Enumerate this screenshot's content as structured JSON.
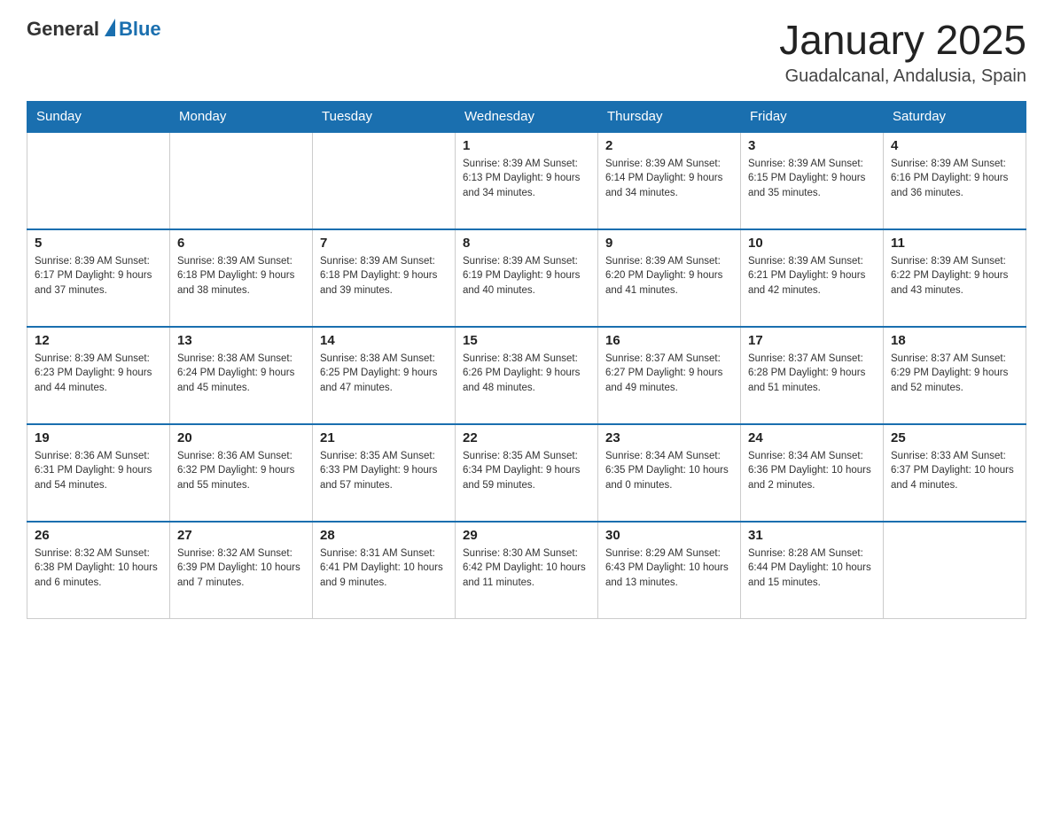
{
  "logo": {
    "general": "General",
    "blue": "Blue"
  },
  "title": "January 2025",
  "location": "Guadalcanal, Andalusia, Spain",
  "weekdays": [
    "Sunday",
    "Monday",
    "Tuesday",
    "Wednesday",
    "Thursday",
    "Friday",
    "Saturday"
  ],
  "weeks": [
    [
      {
        "day": "",
        "info": ""
      },
      {
        "day": "",
        "info": ""
      },
      {
        "day": "",
        "info": ""
      },
      {
        "day": "1",
        "info": "Sunrise: 8:39 AM\nSunset: 6:13 PM\nDaylight: 9 hours\nand 34 minutes."
      },
      {
        "day": "2",
        "info": "Sunrise: 8:39 AM\nSunset: 6:14 PM\nDaylight: 9 hours\nand 34 minutes."
      },
      {
        "day": "3",
        "info": "Sunrise: 8:39 AM\nSunset: 6:15 PM\nDaylight: 9 hours\nand 35 minutes."
      },
      {
        "day": "4",
        "info": "Sunrise: 8:39 AM\nSunset: 6:16 PM\nDaylight: 9 hours\nand 36 minutes."
      }
    ],
    [
      {
        "day": "5",
        "info": "Sunrise: 8:39 AM\nSunset: 6:17 PM\nDaylight: 9 hours\nand 37 minutes."
      },
      {
        "day": "6",
        "info": "Sunrise: 8:39 AM\nSunset: 6:18 PM\nDaylight: 9 hours\nand 38 minutes."
      },
      {
        "day": "7",
        "info": "Sunrise: 8:39 AM\nSunset: 6:18 PM\nDaylight: 9 hours\nand 39 minutes."
      },
      {
        "day": "8",
        "info": "Sunrise: 8:39 AM\nSunset: 6:19 PM\nDaylight: 9 hours\nand 40 minutes."
      },
      {
        "day": "9",
        "info": "Sunrise: 8:39 AM\nSunset: 6:20 PM\nDaylight: 9 hours\nand 41 minutes."
      },
      {
        "day": "10",
        "info": "Sunrise: 8:39 AM\nSunset: 6:21 PM\nDaylight: 9 hours\nand 42 minutes."
      },
      {
        "day": "11",
        "info": "Sunrise: 8:39 AM\nSunset: 6:22 PM\nDaylight: 9 hours\nand 43 minutes."
      }
    ],
    [
      {
        "day": "12",
        "info": "Sunrise: 8:39 AM\nSunset: 6:23 PM\nDaylight: 9 hours\nand 44 minutes."
      },
      {
        "day": "13",
        "info": "Sunrise: 8:38 AM\nSunset: 6:24 PM\nDaylight: 9 hours\nand 45 minutes."
      },
      {
        "day": "14",
        "info": "Sunrise: 8:38 AM\nSunset: 6:25 PM\nDaylight: 9 hours\nand 47 minutes."
      },
      {
        "day": "15",
        "info": "Sunrise: 8:38 AM\nSunset: 6:26 PM\nDaylight: 9 hours\nand 48 minutes."
      },
      {
        "day": "16",
        "info": "Sunrise: 8:37 AM\nSunset: 6:27 PM\nDaylight: 9 hours\nand 49 minutes."
      },
      {
        "day": "17",
        "info": "Sunrise: 8:37 AM\nSunset: 6:28 PM\nDaylight: 9 hours\nand 51 minutes."
      },
      {
        "day": "18",
        "info": "Sunrise: 8:37 AM\nSunset: 6:29 PM\nDaylight: 9 hours\nand 52 minutes."
      }
    ],
    [
      {
        "day": "19",
        "info": "Sunrise: 8:36 AM\nSunset: 6:31 PM\nDaylight: 9 hours\nand 54 minutes."
      },
      {
        "day": "20",
        "info": "Sunrise: 8:36 AM\nSunset: 6:32 PM\nDaylight: 9 hours\nand 55 minutes."
      },
      {
        "day": "21",
        "info": "Sunrise: 8:35 AM\nSunset: 6:33 PM\nDaylight: 9 hours\nand 57 minutes."
      },
      {
        "day": "22",
        "info": "Sunrise: 8:35 AM\nSunset: 6:34 PM\nDaylight: 9 hours\nand 59 minutes."
      },
      {
        "day": "23",
        "info": "Sunrise: 8:34 AM\nSunset: 6:35 PM\nDaylight: 10 hours\nand 0 minutes."
      },
      {
        "day": "24",
        "info": "Sunrise: 8:34 AM\nSunset: 6:36 PM\nDaylight: 10 hours\nand 2 minutes."
      },
      {
        "day": "25",
        "info": "Sunrise: 8:33 AM\nSunset: 6:37 PM\nDaylight: 10 hours\nand 4 minutes."
      }
    ],
    [
      {
        "day": "26",
        "info": "Sunrise: 8:32 AM\nSunset: 6:38 PM\nDaylight: 10 hours\nand 6 minutes."
      },
      {
        "day": "27",
        "info": "Sunrise: 8:32 AM\nSunset: 6:39 PM\nDaylight: 10 hours\nand 7 minutes."
      },
      {
        "day": "28",
        "info": "Sunrise: 8:31 AM\nSunset: 6:41 PM\nDaylight: 10 hours\nand 9 minutes."
      },
      {
        "day": "29",
        "info": "Sunrise: 8:30 AM\nSunset: 6:42 PM\nDaylight: 10 hours\nand 11 minutes."
      },
      {
        "day": "30",
        "info": "Sunrise: 8:29 AM\nSunset: 6:43 PM\nDaylight: 10 hours\nand 13 minutes."
      },
      {
        "day": "31",
        "info": "Sunrise: 8:28 AM\nSunset: 6:44 PM\nDaylight: 10 hours\nand 15 minutes."
      },
      {
        "day": "",
        "info": ""
      }
    ]
  ]
}
